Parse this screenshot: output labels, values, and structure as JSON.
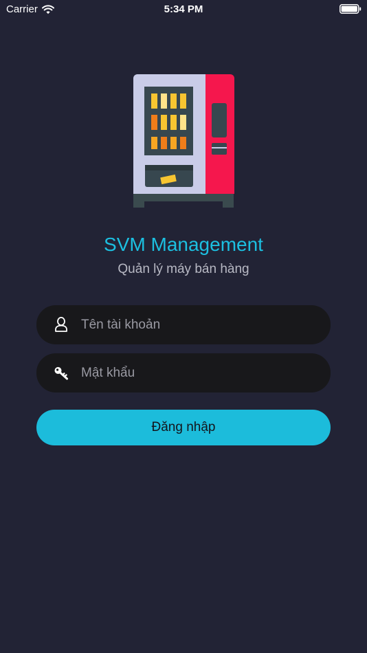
{
  "status_bar": {
    "carrier": "Carrier",
    "time": "5:34 PM",
    "wifi_icon": "wifi-icon",
    "battery_icon": "battery-icon"
  },
  "hero": {
    "icon": "vending-machine-icon"
  },
  "app": {
    "title": "SVM Management",
    "subtitle": "Quản lý máy bán hàng"
  },
  "login_form": {
    "username": {
      "icon": "user-icon",
      "placeholder": "Tên tài khoản",
      "value": ""
    },
    "password": {
      "icon": "key-icon",
      "placeholder": "Mật khẩu",
      "value": ""
    },
    "submit_label": "Đăng nhập"
  },
  "colors": {
    "background": "#222335",
    "accent": "#1cbcdb",
    "field_background": "#18181b",
    "subtitle_text": "#b8b9c4",
    "vending_machine_red": "#f5174d",
    "vending_machine_body": "#c9cce8"
  }
}
